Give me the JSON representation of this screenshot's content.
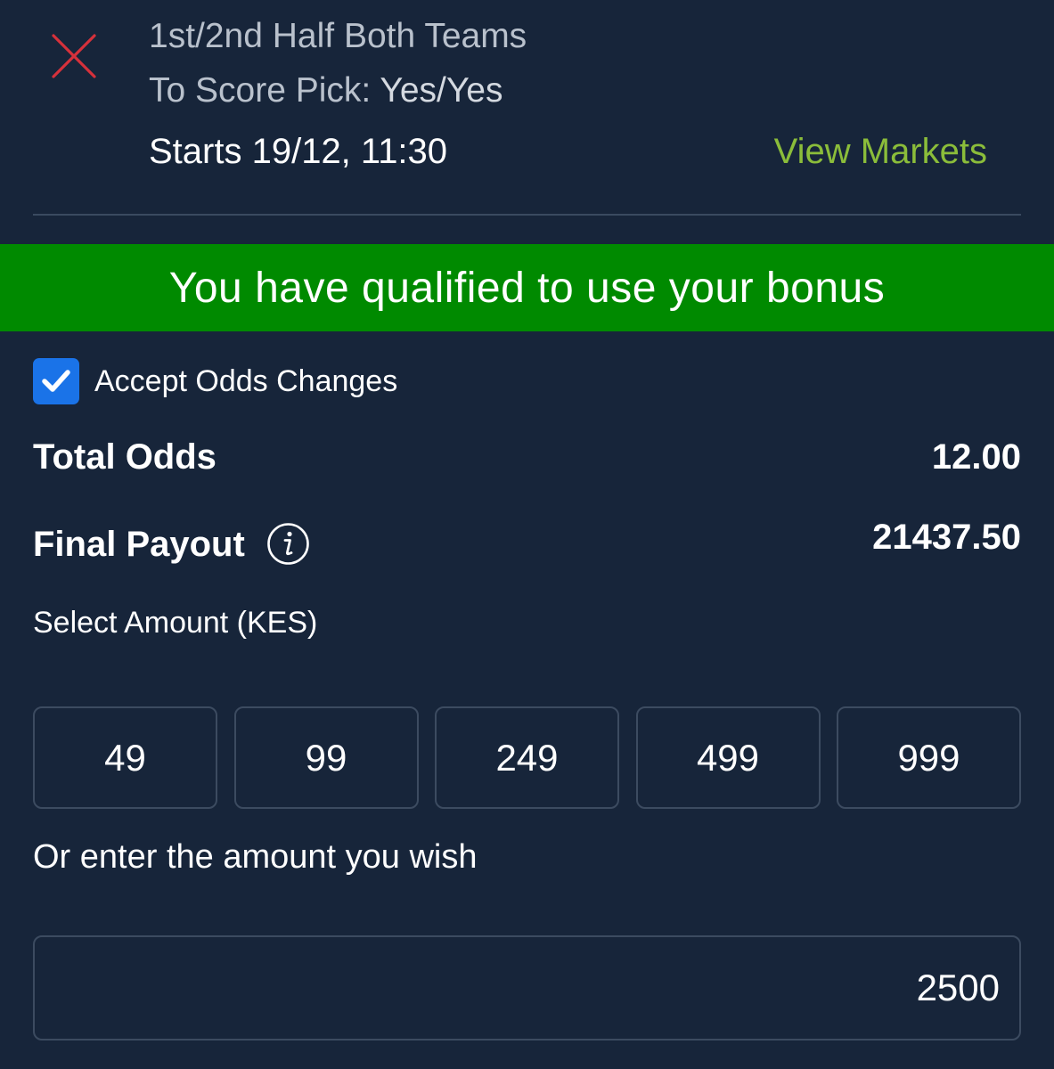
{
  "selection": {
    "remove_icon": "close-icon",
    "market_line1": "1st/2nd Half Both Teams",
    "market_line2_prefix": "To Score",
    "pick_label": "Pick:",
    "pick_value": "Yes/Yes",
    "starts": "Starts 19/12, 11:30",
    "view_markets": "View Markets"
  },
  "bonus_banner": {
    "text": "You have qualified to use your bonus",
    "color": "#008a00"
  },
  "accept_odds": {
    "label": "Accept Odds Changes",
    "checked": true,
    "check_icon": "checkmark-icon"
  },
  "totals": {
    "total_odds_label": "Total Odds",
    "total_odds_value": "12.00",
    "final_payout_label": "Final Payout",
    "final_payout_value": "21437.50",
    "info_icon": "info-icon"
  },
  "stake": {
    "select_label": "Select Amount (KES)",
    "amounts": [
      "49",
      "99",
      "249",
      "499",
      "999"
    ],
    "custom_label": "Or enter the amount you wish",
    "custom_value": "2500"
  },
  "colors": {
    "background": "#17253a",
    "accent_green": "#8bbd3a",
    "close_red": "#d6313b",
    "checkbox_blue": "#1a73e8"
  }
}
